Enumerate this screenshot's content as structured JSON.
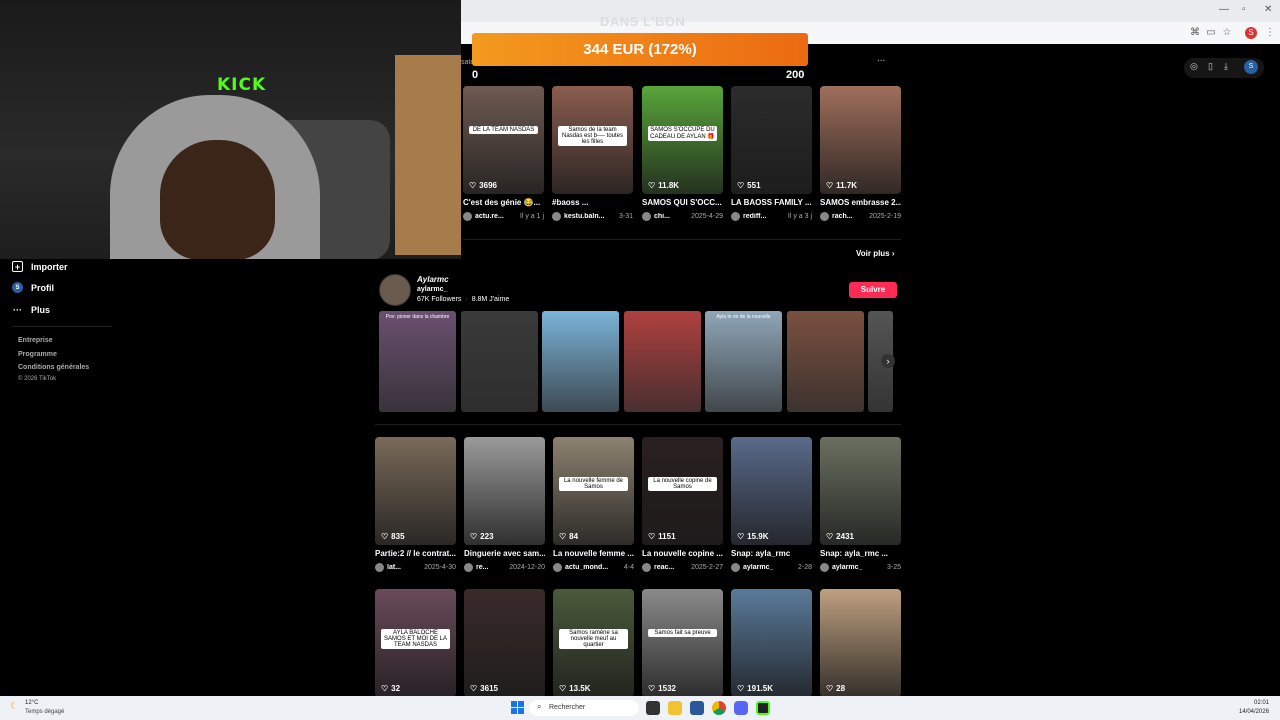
{
  "donation": {
    "title": "DANS L'BON",
    "amount": "344 EUR (172%)",
    "min": "0",
    "max": "200"
  },
  "stream": {
    "brand": "KICK"
  },
  "sidebar": {
    "items": [
      {
        "label": "Importer",
        "icon": "plus-square-icon"
      },
      {
        "label": "Profil",
        "icon": "avatar"
      },
      {
        "label": "Plus",
        "icon": "more-icon"
      }
    ],
    "links": [
      "Entreprise",
      "Programme",
      "Conditions générales",
      "© 2026 TikTok"
    ]
  },
  "search_row": {
    "partial": "sate",
    "more": "..."
  },
  "row1": [
    {
      "likes": "3696",
      "caption": "C'est des génie 😂...",
      "user": "actu.re...",
      "date": "Il y a 1 j",
      "overlay": "DE LA TEAM NASDAS",
      "color": "#6e5a52"
    },
    {
      "likes": "",
      "caption": "#baoss ...",
      "user": "kestu.baln...",
      "date": "3-31",
      "overlay": "Samos de la team Nasdas est b---- toutes les filles",
      "color": "#8a5d4f"
    },
    {
      "likes": "11.8K",
      "caption": "SAMOS QUI S'OCC...",
      "user": "chi...",
      "date": "2025-4-29",
      "overlay": "SAMOS S'OCCUPE DU CADEAU DE AYLAN 🎁",
      "color": "#58a53a"
    },
    {
      "likes": "551",
      "caption": "LA BAOSS FAMILY ...",
      "user": "rediff...",
      "date": "Il y a 3 j",
      "overlay": "",
      "color": "#2b2b2b"
    },
    {
      "likes": "11.7K",
      "caption": "SAMOS embrasse 2...",
      "user": "rach...",
      "date": "2025-2-19",
      "overlay": "",
      "color": "#a06f5c"
    }
  ],
  "voir_plus": "Voir plus",
  "creator": {
    "display": "Aylarmc",
    "handle": "aylarmc_",
    "followers": "67K Followers",
    "likes": "8.8M J'aime",
    "follow": "Suivre"
  },
  "creator_tiles": [
    {
      "overlay": "Pov: pioner dans la chambre",
      "color": "#6a5070"
    },
    {
      "overlay": "",
      "color": "#3a3a3a"
    },
    {
      "overlay": "",
      "color": "#7bb3d8"
    },
    {
      "overlay": "",
      "color": "#b04040"
    },
    {
      "overlay": "Ayla le roi de la nouvelle",
      "color": "#8fa7b8"
    },
    {
      "overlay": "",
      "color": "#7a5040"
    },
    {
      "overlay": "",
      "color": "#555"
    }
  ],
  "row2": [
    {
      "likes": "835",
      "caption": "Partie:2 // le contrat...",
      "user": "lat...",
      "date": "2025-4-30",
      "overlay": "",
      "color": "#7a6a5a"
    },
    {
      "likes": "223",
      "caption": "Dinguerie avec sam...",
      "user": "re...",
      "date": "2024-12-20",
      "overlay": "",
      "color": "#9a9a9a"
    },
    {
      "likes": "84",
      "caption": "La nouvelle femme ...",
      "user": "actu_mond...",
      "date": "4-4",
      "overlay": "La nouvelle femme de Samos",
      "color": "#8d8270"
    },
    {
      "likes": "1151",
      "caption": "La nouvelle copine ...",
      "user": "reac...",
      "date": "2025-2-27",
      "overlay": "La nouvelle copine de Samos",
      "color": "#2a2020"
    },
    {
      "likes": "15.9K",
      "caption": "Snap: ayla_rmc",
      "user": "aylarmc_",
      "date": "2-28",
      "overlay": "",
      "color": "#5a6a8a"
    },
    {
      "likes": "2431",
      "caption": "Snap: ayla_rmc ...",
      "user": "aylarmc_",
      "date": "3-25",
      "overlay": "",
      "color": "#6a7060"
    }
  ],
  "row3": [
    {
      "likes": "32",
      "overlay": "AYLA BALOCHE SAMOS ET MOI DE LA TEAM NASDAS",
      "color": "#6a4a5a"
    },
    {
      "likes": "3615",
      "overlay": "",
      "color": "#3a2a2a"
    },
    {
      "likes": "13.5K",
      "overlay": "Samos ramène sa nouvelle meuf au quartier",
      "color": "#4a5a3a"
    },
    {
      "likes": "1532",
      "overlay": "Samos fait sa preuve",
      "color": "#8a8a8a"
    },
    {
      "likes": "191.5K",
      "overlay": "",
      "color": "#5a7a9a"
    },
    {
      "likes": "28",
      "overlay": "",
      "color": "#bfa080"
    }
  ],
  "taskbar": {
    "weather_temp": "12°C",
    "weather_desc": "Temps dégagé",
    "search": "Rechercher",
    "time": "02:01",
    "date": "14/04/2026"
  }
}
